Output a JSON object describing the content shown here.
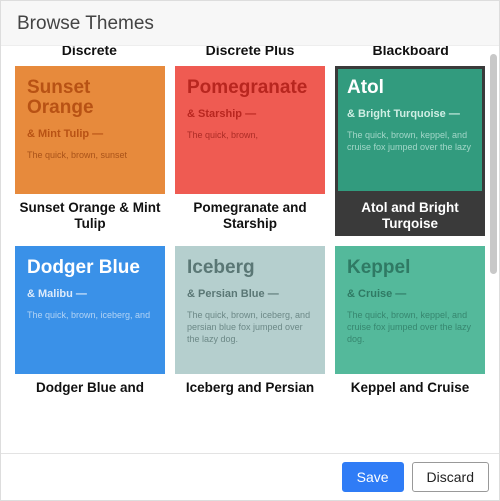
{
  "header": {
    "title": "Browse Themes"
  },
  "peek_labels": [
    "Discrete",
    "Discrete Plus",
    "Blackboard"
  ],
  "themes": [
    {
      "id": "sunset",
      "caption": "Sunset Orange & Mint Tulip",
      "preview_title": "Sunset Orange",
      "preview_sub": "& Mint Tulip —",
      "preview_desc": "The quick, brown, sunset",
      "preview_class": "t-sunset",
      "selected": false
    },
    {
      "id": "pomegranate",
      "caption": "Pomegranate and Starship",
      "preview_title": "Pomegranate",
      "preview_sub": "& Starship —",
      "preview_desc": "The quick, brown,",
      "preview_class": "t-pome",
      "selected": false
    },
    {
      "id": "atol",
      "caption": "Atol and Bright Turqoise",
      "preview_title": "Atol",
      "preview_sub": "& Bright Turquoise —",
      "preview_desc": "The quick, brown, keppel, and cruise fox jumped over the lazy",
      "preview_class": "t-atol",
      "selected": true
    },
    {
      "id": "dodger",
      "caption": "Dodger Blue and",
      "preview_title": "Dodger Blue",
      "preview_sub": "& Malibu —",
      "preview_desc": "The quick, brown, iceberg, and",
      "preview_class": "t-dodger",
      "selected": false
    },
    {
      "id": "iceberg",
      "caption": "Iceberg and Persian",
      "preview_title": "Iceberg",
      "preview_sub": "& Persian Blue —",
      "preview_desc": "The quick, brown, iceberg, and persian blue fox jumped over the lazy dog.",
      "preview_class": "t-iceberg",
      "selected": false
    },
    {
      "id": "keppel",
      "caption": "Keppel and Cruise",
      "preview_title": "Keppel",
      "preview_sub": "& Cruise —",
      "preview_desc": "The quick, brown, keppel, and cruise fox jumped over the lazy dog.",
      "preview_class": "t-keppel",
      "selected": false
    }
  ],
  "footer": {
    "save_label": "Save",
    "discard_label": "Discard"
  }
}
